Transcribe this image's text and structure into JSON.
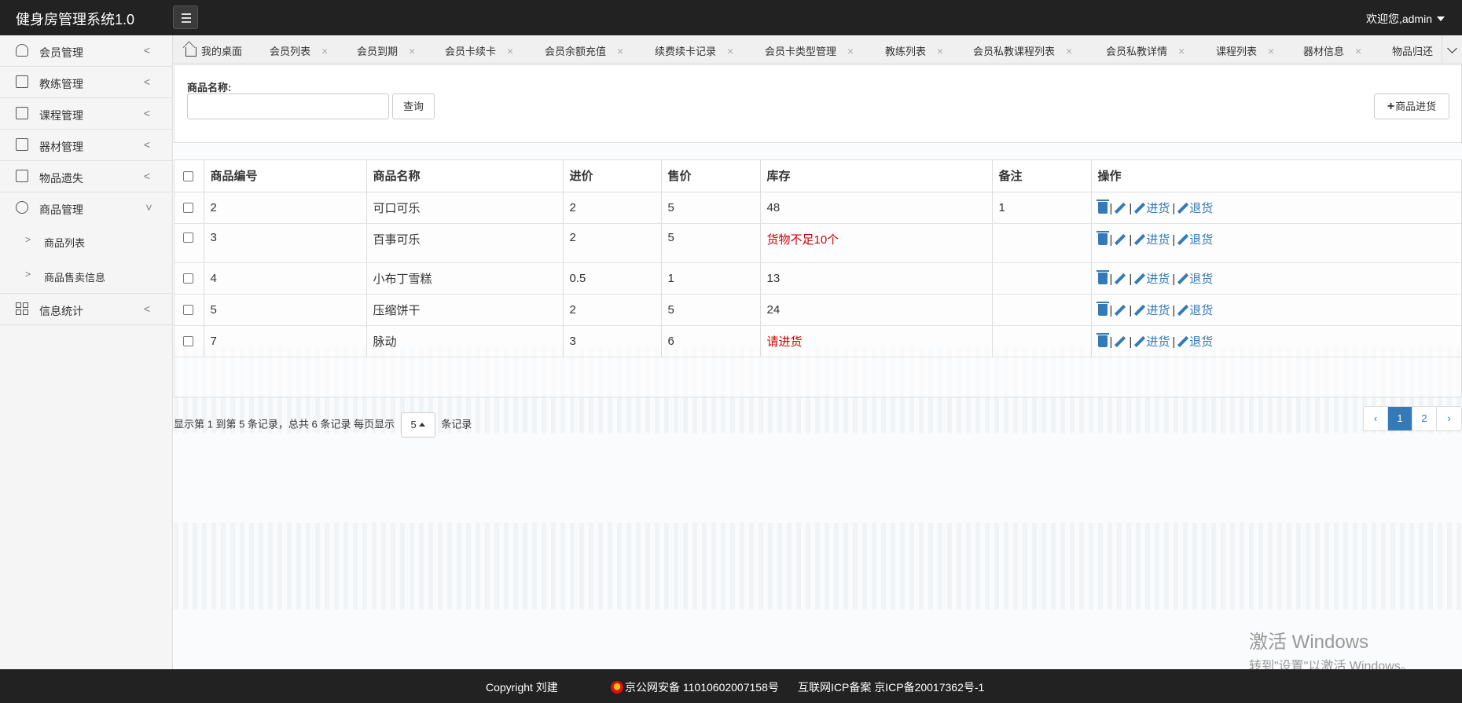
{
  "app": {
    "title": "健身房管理系统1.0",
    "welcome": "欢迎您,admin"
  },
  "sidebar": {
    "items": [
      {
        "label": "会员管理"
      },
      {
        "label": "教练管理"
      },
      {
        "label": "课程管理"
      },
      {
        "label": "器材管理"
      },
      {
        "label": "物品遗失"
      },
      {
        "label": "商品管理"
      },
      {
        "label": "信息统计"
      }
    ],
    "sub_items": [
      {
        "label": "商品列表"
      },
      {
        "label": "商品售卖信息"
      }
    ]
  },
  "tabs": [
    {
      "label": "我的桌面"
    },
    {
      "label": "会员列表"
    },
    {
      "label": "会员到期"
    },
    {
      "label": "会员卡续卡"
    },
    {
      "label": "会员余额充值"
    },
    {
      "label": "续费续卡记录"
    },
    {
      "label": "会员卡类型管理"
    },
    {
      "label": "教练列表"
    },
    {
      "label": "会员私教课程列表"
    },
    {
      "label": "会员私教详情"
    },
    {
      "label": "课程列表"
    },
    {
      "label": "器材信息"
    },
    {
      "label": "物品归还"
    }
  ],
  "search": {
    "label": "商品名称:",
    "value": "",
    "button": "查询"
  },
  "toolbar": {
    "stock_in_label": "商品进货"
  },
  "table": {
    "headers": [
      "商品编号",
      "商品名称",
      "进价",
      "售价",
      "库存",
      "备注",
      "操作"
    ],
    "rows": [
      {
        "id": "2",
        "name": "可口可乐",
        "cost": "2",
        "price": "5",
        "stock": "48",
        "note": "1"
      },
      {
        "id": "3",
        "name": "百事可乐",
        "cost": "2",
        "price": "5",
        "stock": "货物不足10个",
        "note": ""
      },
      {
        "id": "4",
        "name": "小布丁雪糕",
        "cost": "0.5",
        "price": "1",
        "stock": "13",
        "note": ""
      },
      {
        "id": "5",
        "name": "压缩饼干",
        "cost": "2",
        "price": "5",
        "stock": "24",
        "note": ""
      },
      {
        "id": "7",
        "name": "脉动",
        "cost": "3",
        "price": "6",
        "stock": "请进货",
        "note": ""
      }
    ],
    "actions": {
      "stock_in": "进货",
      "return": "退货",
      "separator": "|"
    }
  },
  "pager": {
    "info_prefix": "显示第 1 到第 5 条记录，总共 6 条记录 每页显示",
    "page_size": "5",
    "info_suffix": "条记录",
    "prev": "‹",
    "next": "›",
    "pages": [
      "1",
      "2"
    ],
    "current": "1"
  },
  "os_watermark": {
    "line1": "激活 Windows",
    "line2": "转到\"设置\"以激活 Windows。"
  },
  "footer": {
    "copyright": "Copyright 刘建",
    "police": "京公网安备 11010602007158号",
    "icp": "互联网ICP备案 京ICP备20017362号-1"
  },
  "colors": {
    "topbar": "#222222",
    "link": "#337ab7",
    "warning": "#cc0000",
    "active_page": "#337ab7"
  }
}
